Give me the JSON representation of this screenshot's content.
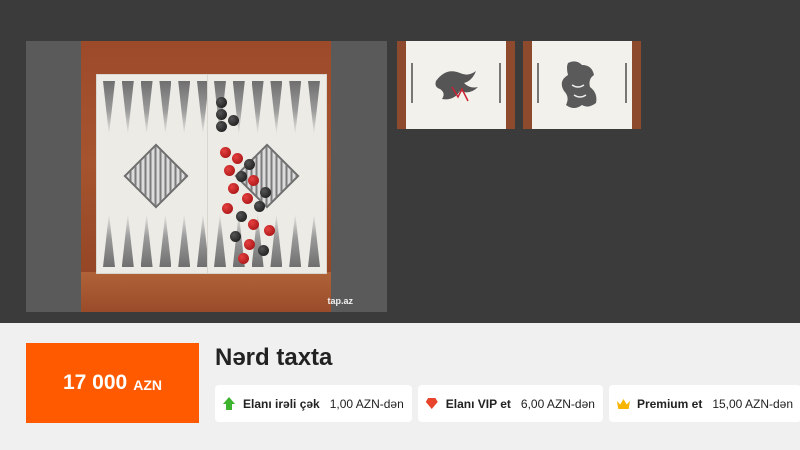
{
  "gallery": {
    "main_photo_alt": "Nərd taxta",
    "watermark": "tap.az",
    "thumbnails": [
      "thumbnail-1",
      "thumbnail-2"
    ]
  },
  "listing": {
    "price_amount": "17 000",
    "price_currency": "AZN",
    "title": "Nərd taxta"
  },
  "services": [
    {
      "icon": "arrow-up-icon",
      "name": "Elanı irəli çək",
      "price": "1,00 AZN-dən",
      "color": "#3eb32e"
    },
    {
      "icon": "diamond-icon",
      "name": "Elanı VIP et",
      "price": "6,00 AZN-dən",
      "color": "#e8442c"
    },
    {
      "icon": "crown-icon",
      "name": "Premium et",
      "price": "15,00 AZN-dən",
      "color": "#f7b500"
    }
  ],
  "colors": {
    "accent": "#ff5a00",
    "gallery_bg": "#3b3b3b",
    "info_bg": "#f0f0f0"
  }
}
